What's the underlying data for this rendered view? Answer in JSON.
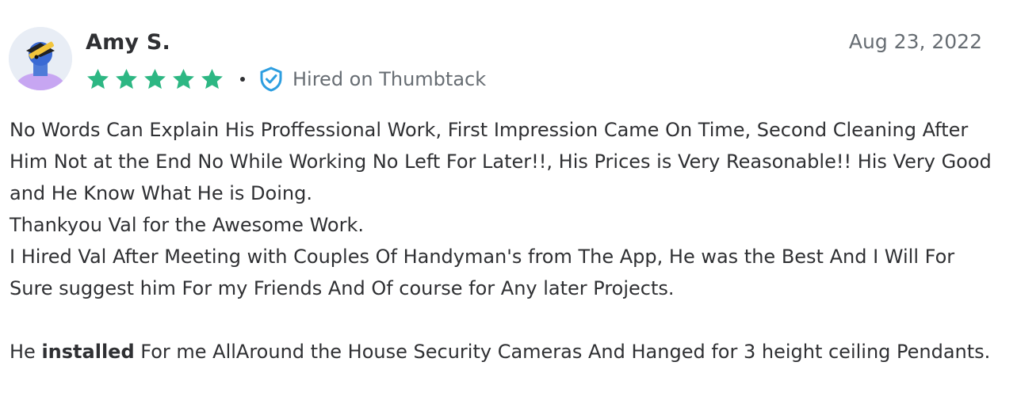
{
  "review": {
    "author": "Amy S.",
    "date": "Aug 23, 2022",
    "rating": 5,
    "rating_max": 5,
    "badge_text": "Hired on Thumbtack",
    "lines": [
      "No Words Can Explain His Proffessional Work, First Impression Came On Time, Second Cleaning After Him Not at the End No While Working No Left For Later!!, His Prices is Very Reasonable!! His Very Good and He Know What He is Doing.",
      "Thankyou Val for the Awesome Work.",
      "I Hired Val After Meeting with Couples Of Handyman's from The App, He was the Best And I Will For Sure suggest him For my Friends And Of course for Any later Projects."
    ],
    "last_line": {
      "prefix": "He ",
      "bold": "installed",
      "suffix": " For me AllAround the House Security Cameras And Hanged for 3 height ceiling Pendants."
    }
  },
  "colors": {
    "star": "#2db783",
    "shield": "#2d9ee0",
    "text": "#2f3033",
    "muted": "#676d73"
  },
  "icons": {
    "avatar": "avatar-icon",
    "star": "star-icon",
    "badge": "verified-shield-icon"
  }
}
